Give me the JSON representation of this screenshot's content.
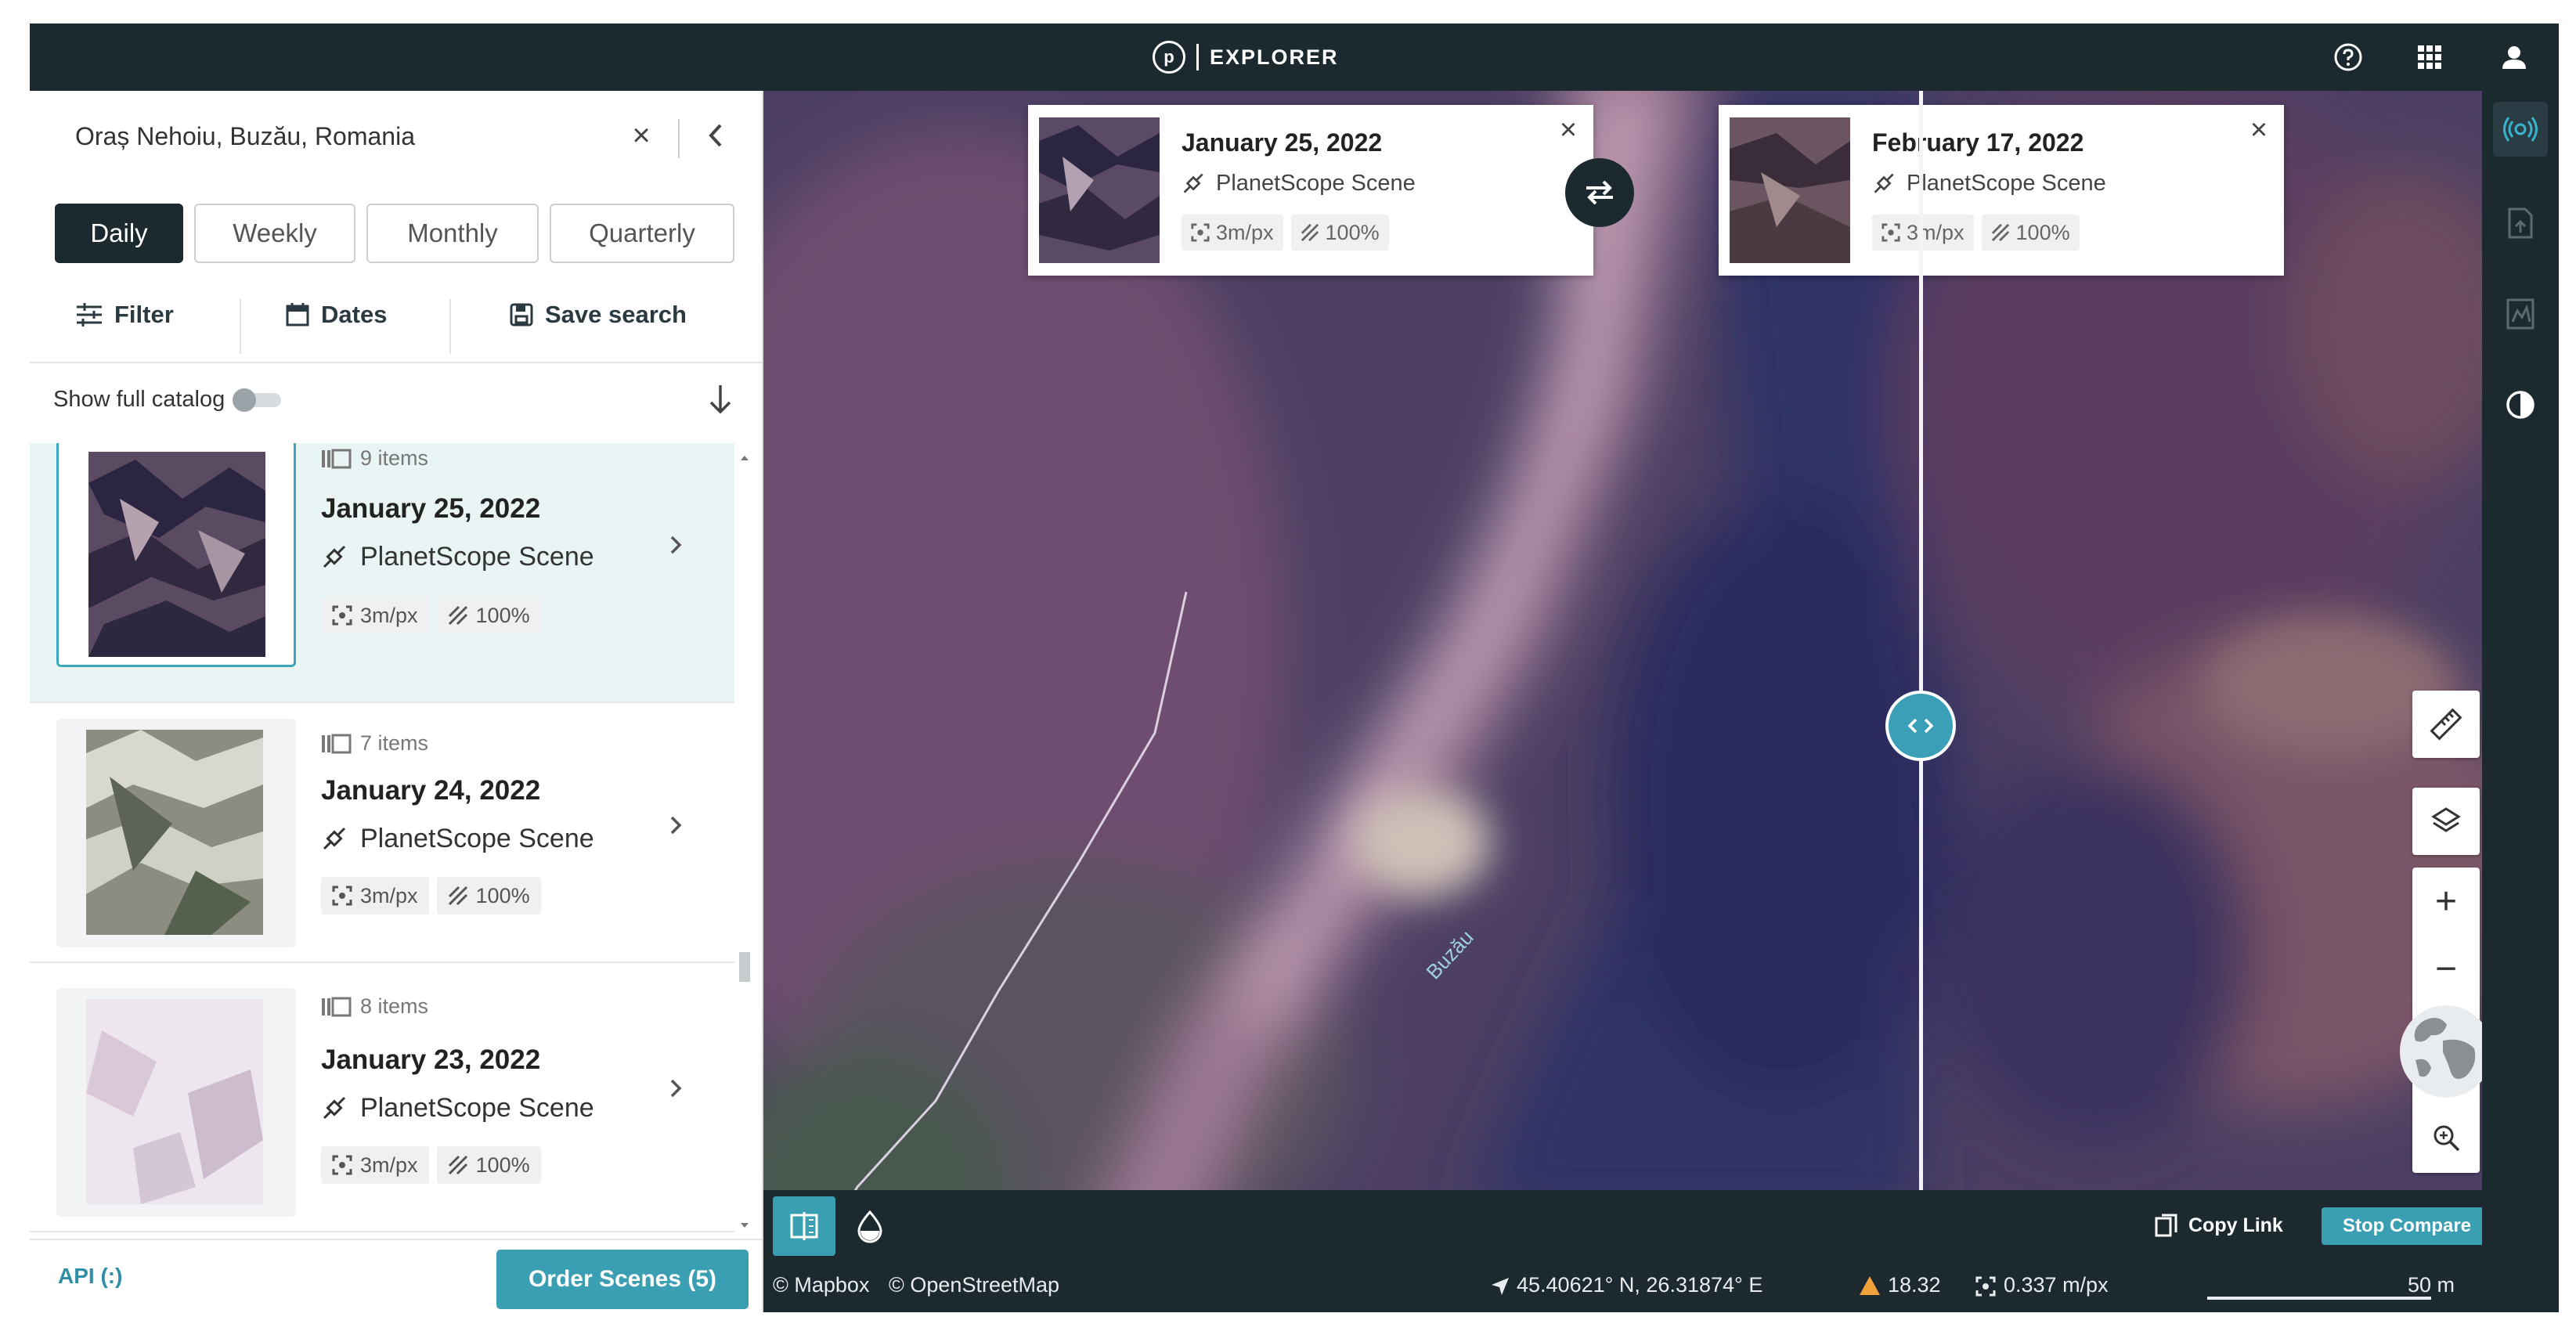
{
  "app": {
    "title": "EXPLORER",
    "logo_letter": "p"
  },
  "search": {
    "value": "Oraș Nehoiu, Buzău, Romania"
  },
  "tabs": [
    {
      "label": "Daily",
      "active": true
    },
    {
      "label": "Weekly",
      "active": false
    },
    {
      "label": "Monthly",
      "active": false
    },
    {
      "label": "Quarterly",
      "active": false
    }
  ],
  "actions": {
    "filter": "Filter",
    "dates": "Dates",
    "save": "Save search"
  },
  "catalog": {
    "label": "Show full catalog",
    "enabled": false
  },
  "results": [
    {
      "count": "9 items",
      "date": "January 25, 2022",
      "source": "PlanetScope Scene",
      "resolution": "3m/px",
      "coverage": "100%",
      "selected": true
    },
    {
      "count": "7 items",
      "date": "January 24, 2022",
      "source": "PlanetScope Scene",
      "resolution": "3m/px",
      "coverage": "100%",
      "selected": false
    },
    {
      "count": "8 items",
      "date": "January 23, 2022",
      "source": "PlanetScope Scene",
      "resolution": "3m/px",
      "coverage": "100%",
      "selected": false
    }
  ],
  "footer": {
    "api": "API (:)",
    "order": "Order Scenes (5)"
  },
  "compare": {
    "left": {
      "date": "January 25, 2022",
      "source": "PlanetScope Scene",
      "resolution": "3m/px",
      "coverage": "100%"
    },
    "right": {
      "date": "February 17, 2022",
      "source": "PlanetScope Scene",
      "resolution": "3m/px",
      "coverage": "100%"
    }
  },
  "map": {
    "river_label": "Buzău",
    "copy_link": "Copy Link",
    "stop_compare": "Stop Compare",
    "attribution_mapbox": "© Mapbox",
    "attribution_osm": "© OpenStreetMap",
    "coordinates": "45.40621° N, 26.31874° E",
    "elevation": "18.32",
    "pixel_size": "0.337 m/px",
    "scale": "50 m"
  },
  "colors": {
    "accent": "#3b9fb3",
    "dark": "#1c2a30"
  }
}
